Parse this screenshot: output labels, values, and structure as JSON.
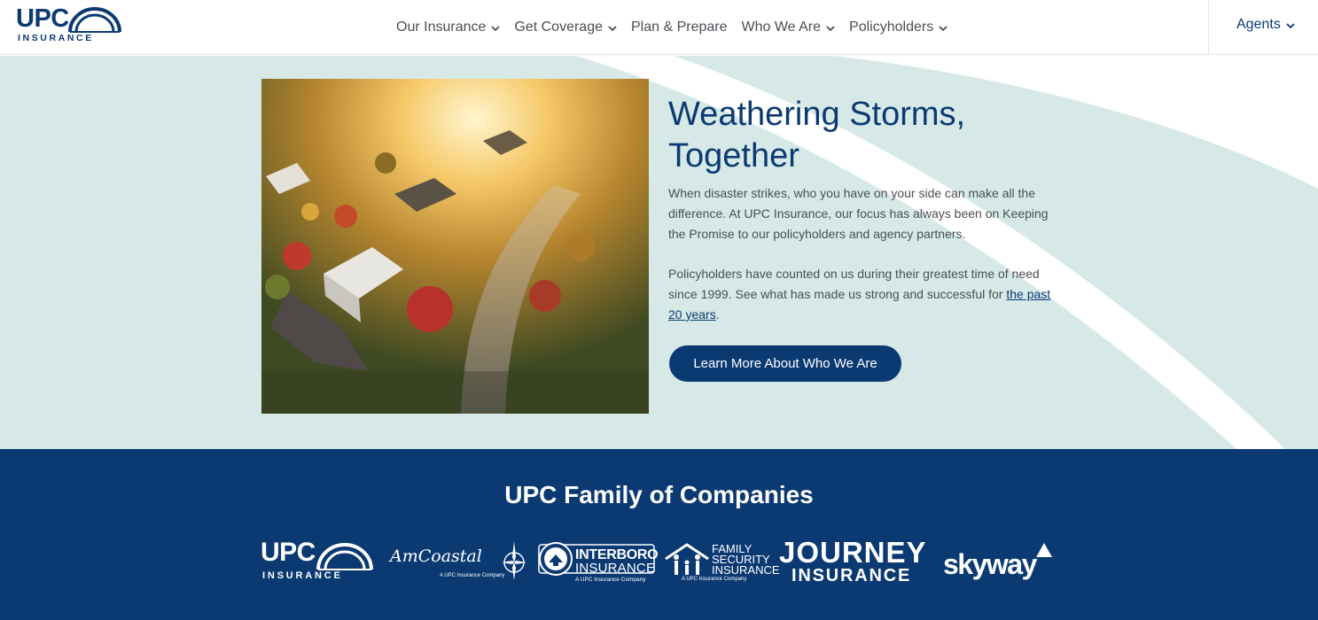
{
  "header": {
    "logo": {
      "word": "UPC",
      "sub": "INSURANCE"
    },
    "nav": [
      {
        "label": "Our Insurance",
        "has_dropdown": true
      },
      {
        "label": "Get Coverage",
        "has_dropdown": true
      },
      {
        "label": "Plan & Prepare",
        "has_dropdown": false
      },
      {
        "label": "Who We Are",
        "has_dropdown": true
      },
      {
        "label": "Policyholders",
        "has_dropdown": true
      }
    ],
    "agents_label": "Agents"
  },
  "hero": {
    "headline": "Weathering Storms, Together",
    "para1": "When disaster strikes, who you have on your side can make all the difference. At UPC Insurance, our focus has always been on Keeping the Promise to our policyholders and agency partners.",
    "para2_text": "Policyholders have counted on us during their greatest time of need since 1999. See what has made us strong and successful for ",
    "para2_link": "the past 20 years",
    "para2_end": ".",
    "cta_label": "Learn More About Who We Are"
  },
  "family": {
    "title": "UPC Family of Companies",
    "brands": {
      "upc": {
        "word": "UPC",
        "sub": "INSURANCE"
      },
      "amcoastal": {
        "word": "AmCoastal",
        "sub": "A UPC Insurance Company"
      },
      "interboro": {
        "word": "INTERBORO",
        "word2": "INSURANCE",
        "sub": "A UPC Insurance Company"
      },
      "family_security": {
        "line1": "FAMILY",
        "line2": "SECURITY",
        "line3": "INSURANCE",
        "sub": "A UPC Insurance Company"
      },
      "journey": {
        "word": "JOURNEY",
        "word2": "INSURANCE"
      },
      "skyway": {
        "word": "skyway"
      }
    }
  },
  "colors": {
    "navy": "#0b3a73",
    "hero_bg": "#d6e9e7",
    "white": "#ffffff",
    "text": "#4a4f55"
  }
}
